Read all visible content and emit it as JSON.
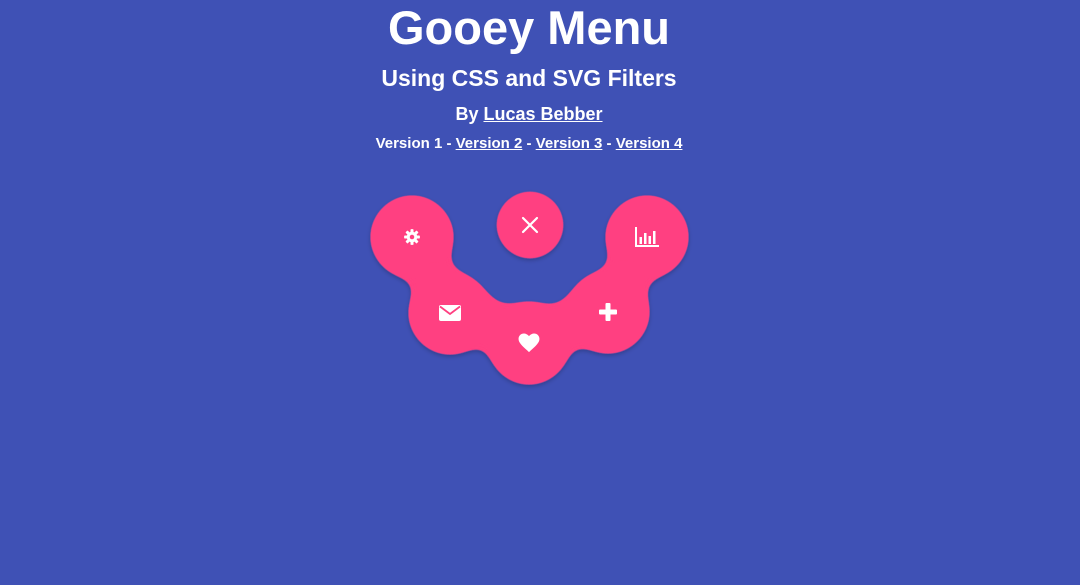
{
  "header": {
    "title": "Gooey Menu",
    "subtitle": "Using CSS and SVG Filters",
    "byline_prefix": "By ",
    "author": "Lucas Bebber",
    "versions": {
      "current": "Version 1",
      "separator": " - ",
      "links": [
        "Version 2",
        "Version 3",
        "Version 4"
      ]
    }
  },
  "menu": {
    "toggle_icon": "close-icon",
    "items": [
      {
        "icon": "gear-icon"
      },
      {
        "icon": "envelope-icon"
      },
      {
        "icon": "heart-icon"
      },
      {
        "icon": "plus-icon"
      },
      {
        "icon": "bar-chart-icon"
      }
    ]
  },
  "colors": {
    "background": "#3f51b5",
    "accent": "#ff4081",
    "icon": "#ffffff"
  }
}
